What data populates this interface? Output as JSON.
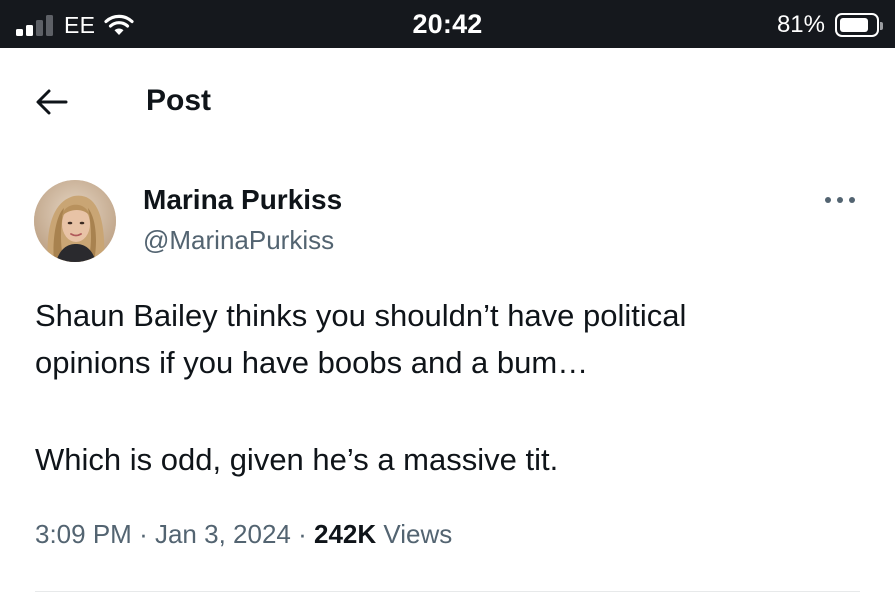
{
  "status_bar": {
    "carrier": "EE",
    "time": "20:42",
    "battery_percent": "81%",
    "battery_level": 0.81,
    "signal_bars_active": 2,
    "signal_bars_total": 4
  },
  "header": {
    "title": "Post"
  },
  "post": {
    "author_name": "Marina Purkiss",
    "author_handle": "@MarinaPurkiss",
    "text_lines": [
      "Shaun Bailey thinks you shouldn’t have political",
      "opinions if you have boobs and a bum…",
      "Which is odd, given he’s a massive tit."
    ],
    "time": "3:09 PM",
    "separator": "·",
    "date": "Jan 3, 2024",
    "views_count": "242K",
    "views_label": "Views"
  },
  "colors": {
    "status_bar_bg": "#15181d",
    "text_primary": "#0f1419",
    "text_secondary": "#536471",
    "divider": "#e7e9ea"
  },
  "icons": {
    "back": "arrow-left-icon",
    "more": "more-horizontal-icon",
    "signal": "cellular-signal-icon",
    "wifi": "wifi-icon",
    "battery": "battery-icon"
  }
}
